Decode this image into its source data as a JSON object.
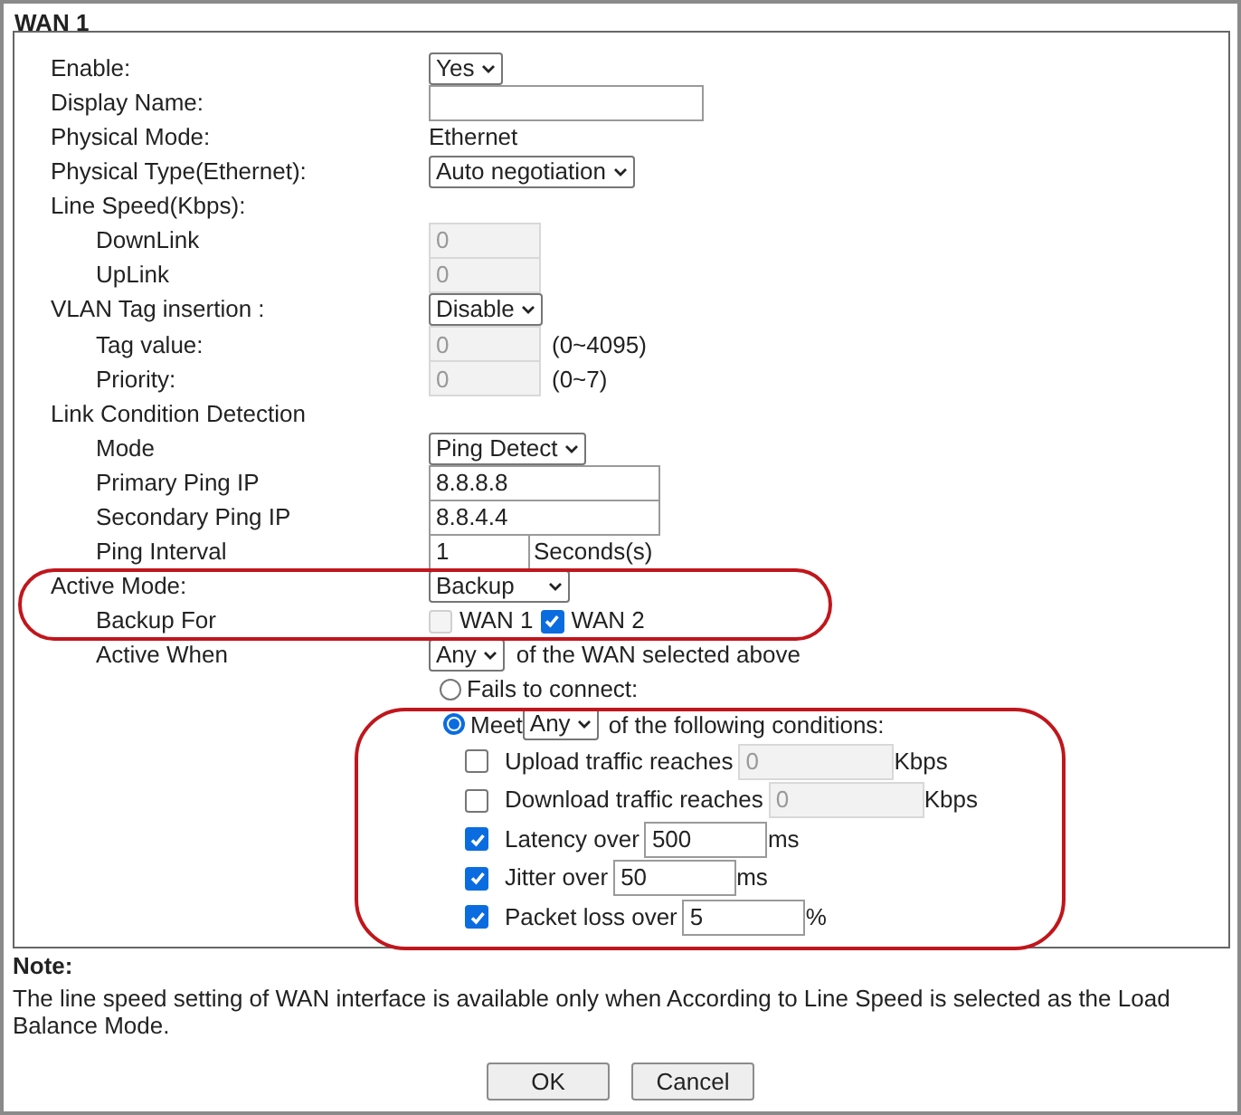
{
  "title": "WAN 1",
  "rows": [
    {
      "label": "Enable:",
      "kind": "select",
      "value": "Yes"
    },
    {
      "label": "Display Name:",
      "kind": "input"
    },
    {
      "label": "Physical Mode:",
      "kind": "text",
      "value": "Ethernet"
    },
    {
      "label": "Physical Type(Ethernet):",
      "kind": "select",
      "value": "Auto negotiation"
    },
    {
      "label": "Line Speed(Kbps):",
      "kind": "heading",
      "children": [
        {
          "label": "DownLink",
          "kind": "input",
          "value": "0",
          "disabled": true
        },
        {
          "label": "UpLink",
          "kind": "input",
          "value": "0",
          "disabled": true
        }
      ]
    },
    {
      "label": "VLAN Tag insertion :",
      "kind": "select",
      "value": "Disable",
      "children": [
        {
          "label": "Tag value:",
          "kind": "input",
          "value": "0",
          "disabled": true,
          "suffix": "(0~4095)"
        },
        {
          "label": "Priority:",
          "kind": "input",
          "value": "0",
          "disabled": true,
          "suffix": "(0~7)"
        }
      ]
    },
    {
      "label": "Link Condition Detection",
      "kind": "heading",
      "children": [
        {
          "label": "Mode",
          "kind": "select",
          "value": "Ping Detect"
        },
        {
          "label": "Primary Ping IP",
          "kind": "input",
          "value": "8.8.8.8"
        },
        {
          "label": "Secondary Ping IP",
          "kind": "input",
          "value": "8.8.4.4"
        },
        {
          "label": "Ping Interval",
          "kind": "input",
          "value": "1",
          "suffix": "Seconds(s)"
        }
      ]
    },
    {
      "label": "Active Mode:",
      "kind": "select",
      "value": "Backup",
      "children": [
        {
          "label": "Backup For",
          "kind": "checks",
          "options": [
            {
              "label": "WAN 1",
              "checked": false,
              "disabled": true
            },
            {
              "label": "WAN 2",
              "checked": true,
              "disabled": false
            }
          ]
        },
        {
          "label": "Active When",
          "kind": "select",
          "value": "Any",
          "suffix": "of the WAN selected above"
        }
      ]
    }
  ],
  "trigger": [
    {
      "label": "Fails to connect:",
      "selected": false
    },
    {
      "label": "Meet",
      "selected": true,
      "select": "Any",
      "suffix": "of the following conditions:"
    }
  ],
  "conditions": [
    {
      "label": "Upload traffic reaches",
      "checked": false,
      "value": "0",
      "disabled": true,
      "unit": "Kbps"
    },
    {
      "label": "Download traffic reaches",
      "checked": false,
      "value": "0",
      "disabled": true,
      "unit": "Kbps"
    },
    {
      "label": "Latency over",
      "checked": true,
      "value": "500",
      "disabled": false,
      "unit": "ms"
    },
    {
      "label": "Jitter over",
      "checked": true,
      "value": "50",
      "disabled": false,
      "unit": "ms"
    },
    {
      "label": "Packet loss over",
      "checked": true,
      "value": "5",
      "disabled": false,
      "unit": "%"
    }
  ],
  "note": {
    "title": "Note:",
    "text": "The line speed setting of WAN interface is available only when According to Line Speed is selected as the Load Balance Mode."
  },
  "buttons": [
    "OK",
    "Cancel"
  ]
}
